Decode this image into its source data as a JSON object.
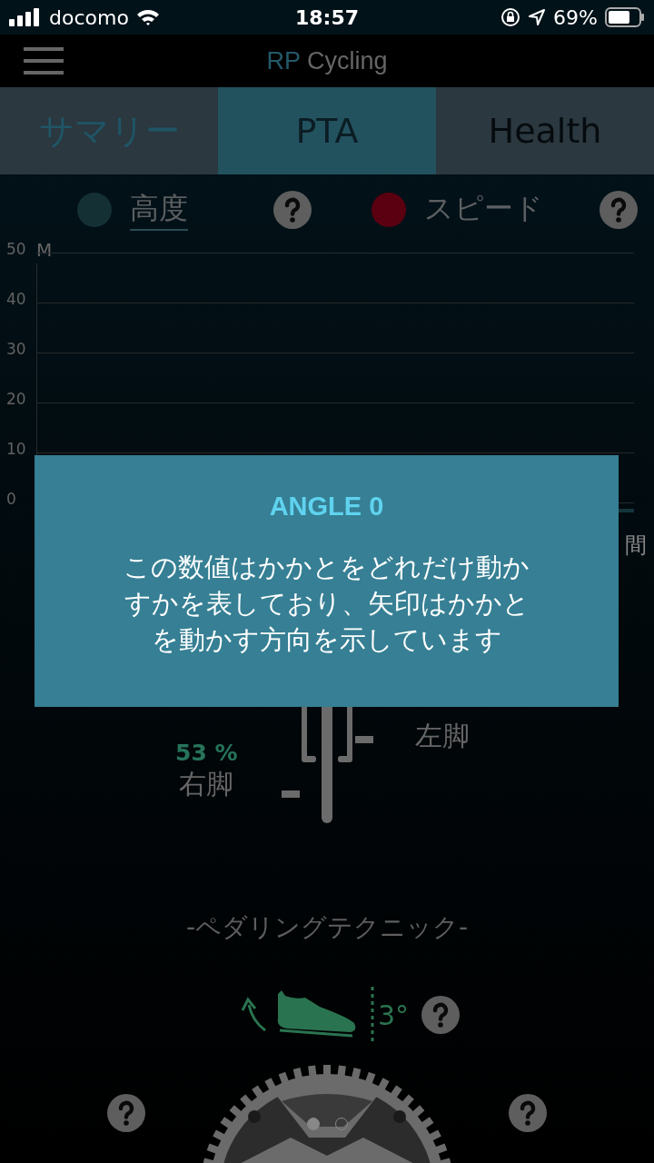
{
  "status_bar": {
    "carrier": "docomo",
    "time": "18:57",
    "battery": "69%"
  },
  "nav_bar": {
    "title_prefix": "RP",
    "title": "Cycling"
  },
  "tabs": [
    {
      "label": "サマリー",
      "selected": false
    },
    {
      "label": "PTA",
      "selected": true
    },
    {
      "label": "Health",
      "selected": false
    }
  ],
  "legend": [
    {
      "label": "高度",
      "color": "#143035",
      "selected": true
    },
    {
      "label": "スピード",
      "color": "#5a0010",
      "selected": false
    }
  ],
  "chart": {
    "unit": "M",
    "y_labels": [
      "50",
      "40",
      "30",
      "20",
      "10",
      "0"
    ],
    "x_label": "間"
  },
  "balance": {
    "left_label": "左脚",
    "right_value": "53 %",
    "right_label": "右脚"
  },
  "technique": {
    "title": "-ペダリングテクニック-",
    "angle": "3°"
  },
  "pager": [
    {
      "selected": true
    },
    {
      "selected": false
    }
  ],
  "popup": {
    "title": "ANGLE 0",
    "body": "この数値はかかとをどれだけ動かすかを表しており、矢印はかかとを動かす方向を示しています"
  }
}
